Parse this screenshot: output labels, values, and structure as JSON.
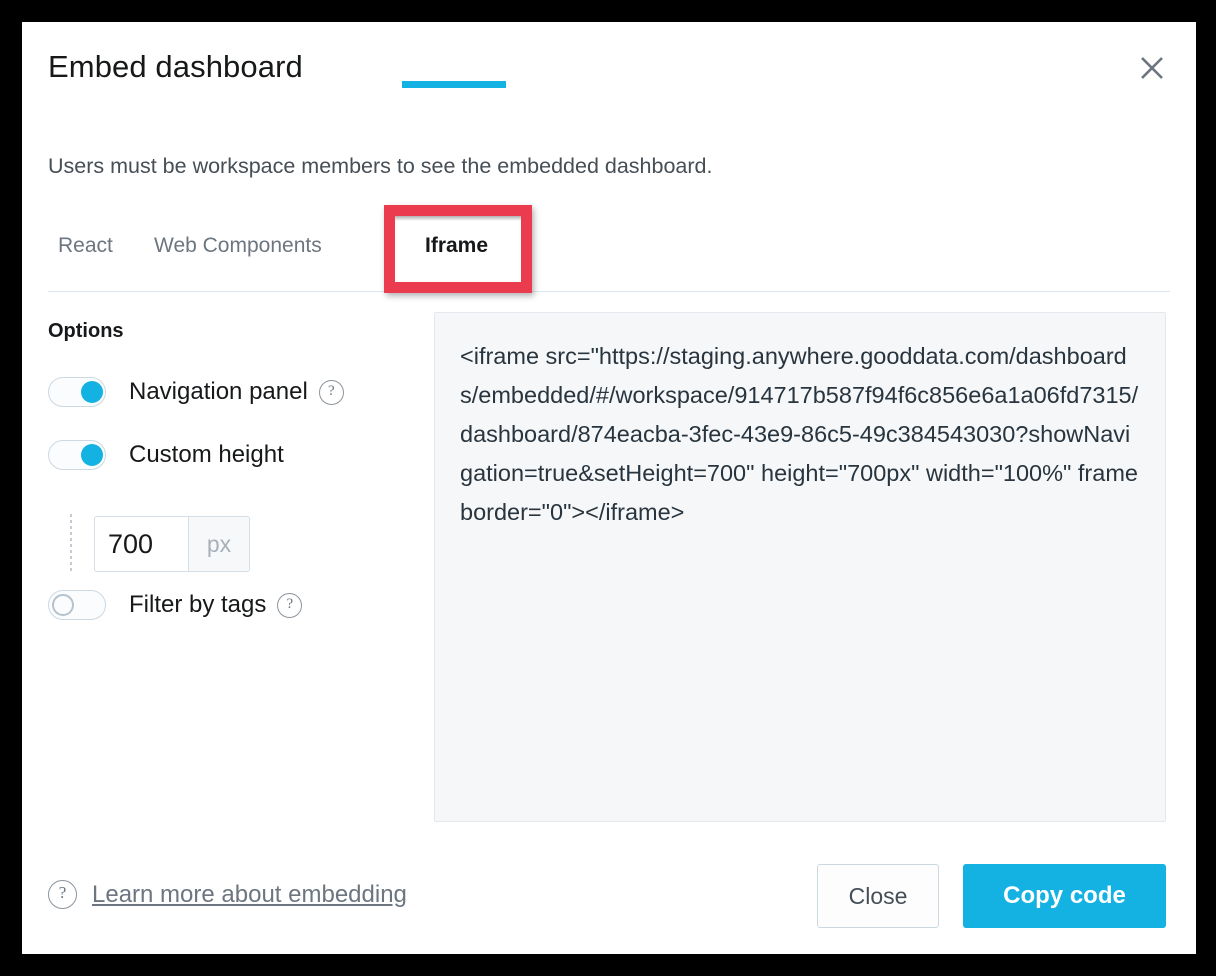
{
  "dialog": {
    "title": "Embed dashboard",
    "subtitle": "Users must be workspace members to see the embedded dashboard.",
    "close_icon": "close-icon"
  },
  "tabs": {
    "items": [
      {
        "label": "React",
        "active": false
      },
      {
        "label": "Web Components",
        "active": false
      },
      {
        "label": "Iframe",
        "active": true
      }
    ],
    "active_index": 2,
    "accent_color": "#14b2e2",
    "annotation_color": "#ea3b4f"
  },
  "options": {
    "title": "Options",
    "toggles": [
      {
        "label": "Navigation panel",
        "state": "on",
        "has_help": true
      },
      {
        "label": "Custom height",
        "state": "on",
        "has_help": false
      },
      {
        "label": "Filter by tags",
        "state": "off",
        "has_help": true
      }
    ],
    "height_input": {
      "value": "700",
      "placeholder": "700",
      "unit": "px"
    },
    "help_glyph": "?"
  },
  "code": {
    "snippet": "<iframe src=\"https://staging.anywhere.gooddata.com/dashboards/embedded/#/workspace/914717b587f94f6c856e6a1a06fd7315/dashboard/874eacba-3fec-43e9-86c5-49c384543030?showNavigation=true&setHeight=700\" height=\"700px\" width=\"100%\" frameborder=\"0\"></iframe>"
  },
  "footer": {
    "learn_more": "Learn more about embedding",
    "close_label": "Close",
    "copy_label": "Copy code"
  }
}
